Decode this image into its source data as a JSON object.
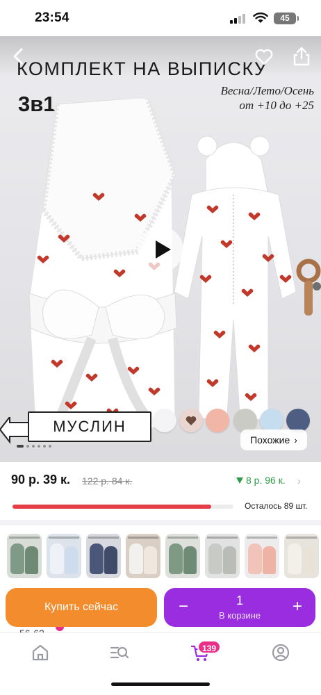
{
  "status_bar": {
    "time": "23:54",
    "battery": "45"
  },
  "hero": {
    "title": "КОМПЛЕКТ НА ВЫПИСКУ",
    "subtitle": "3в1",
    "season_line1": "Весна/Лето/Осень",
    "season_line2": "от +10 до +25",
    "material_label": "МУСЛИН",
    "similar_label": "Похожие",
    "similar_chevron": "›",
    "swatch_colors": [
      "#f4f4f6",
      "#ead6d0",
      "#f2b6a6",
      "#c9cbc4",
      "#c6dcef",
      "#4e5e82"
    ],
    "heart_color": "#c0392b",
    "slide_count": 6,
    "active_slide": 1
  },
  "price": {
    "current": "90 р. 39 к.",
    "old": "122 р. 84 к.",
    "alternative": "8 р. 96 к.",
    "alternative_color": "#2e9c47",
    "chevron": "›"
  },
  "stock": {
    "text": "Осталось 89 шт.",
    "fill_fraction": 0.9,
    "bar_color": "#e53d46"
  },
  "variants": [
    {
      "color_a": "#7f9a86",
      "color_b": "#6e8a74",
      "bg": "#d9ddd8"
    },
    {
      "color_a": "#eef2f8",
      "color_b": "#cfdcee",
      "bg": "#dde3ea"
    },
    {
      "color_a": "#4a5778",
      "color_b": "#3f4b68",
      "bg": "#d7d9df"
    },
    {
      "color_a": "#f3f1ee",
      "color_b": "#f0e8df",
      "bg": "#d9cfc4"
    },
    {
      "color_a": "#7e9a84",
      "color_b": "#6f8b76",
      "bg": "#dde0db"
    },
    {
      "color_a": "#c8cac6",
      "color_b": "#b9bcb7",
      "bg": "#e2e2e2"
    },
    {
      "color_a": "#f2c3b8",
      "color_b": "#efb3a6",
      "bg": "#ececec"
    },
    {
      "color_a": "#f3f0ea",
      "color_b": "#e9e2d6",
      "bg": "#e7e4de"
    }
  ],
  "actions": {
    "buy_now": "Купить сейчас",
    "minus": "−",
    "quantity": "1",
    "in_cart": "В корзине",
    "plus": "+"
  },
  "size_peek": "56-62",
  "tabbar": {
    "cart_count": "139",
    "accent": "#9b2de0",
    "icons": [
      "home-icon",
      "catalog-search-icon",
      "cart-icon",
      "profile-icon"
    ]
  }
}
